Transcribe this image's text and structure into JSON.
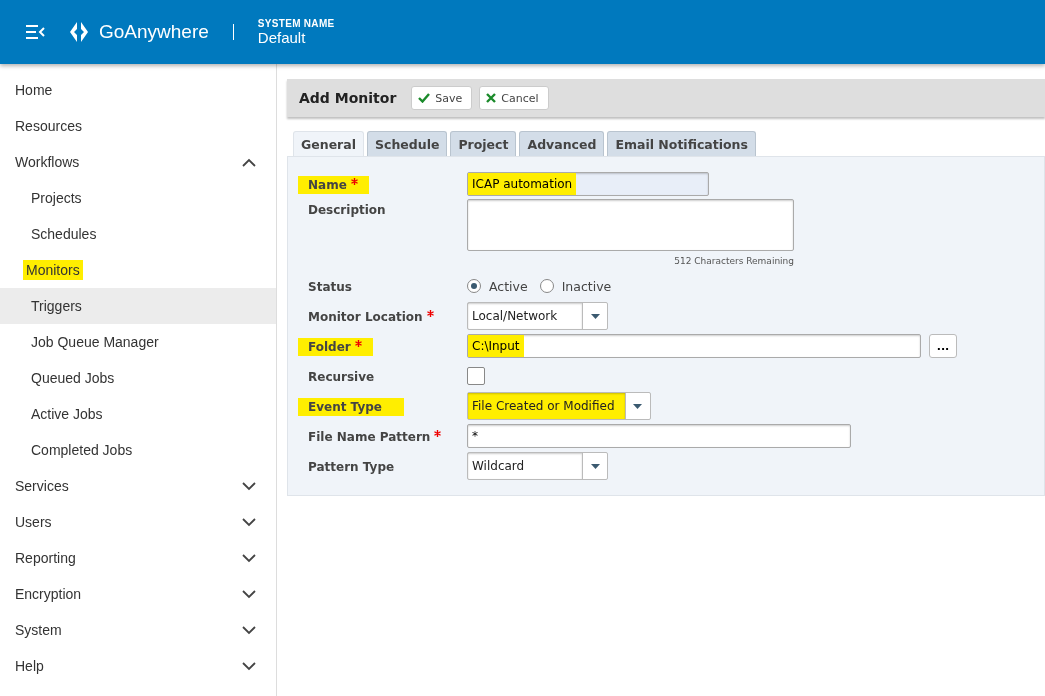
{
  "header": {
    "app_name": "GoAnywhere",
    "system_label": "SYSTEM NAME",
    "system_name": "Default"
  },
  "sidebar": {
    "items": [
      {
        "label": "Home",
        "highlighted": false
      },
      {
        "label": "Resources",
        "highlighted": false
      },
      {
        "label": "Workflows",
        "highlighted": false,
        "expanded": true,
        "children": [
          {
            "label": "Projects",
            "highlighted": false,
            "hovered": false
          },
          {
            "label": "Schedules",
            "highlighted": false,
            "hovered": false
          },
          {
            "label": "Monitors",
            "highlighted": true,
            "hovered": false
          },
          {
            "label": "Triggers",
            "highlighted": false,
            "hovered": true
          },
          {
            "label": "Job Queue Manager",
            "highlighted": false,
            "hovered": false
          },
          {
            "label": "Queued Jobs",
            "highlighted": false,
            "hovered": false
          },
          {
            "label": "Active Jobs",
            "highlighted": false,
            "hovered": false
          },
          {
            "label": "Completed Jobs",
            "highlighted": false,
            "hovered": false
          }
        ]
      },
      {
        "label": "Services",
        "highlighted": false,
        "expanded": false
      },
      {
        "label": "Users",
        "highlighted": false,
        "expanded": false
      },
      {
        "label": "Reporting",
        "highlighted": false,
        "expanded": false
      },
      {
        "label": "Encryption",
        "highlighted": false,
        "expanded": false
      },
      {
        "label": "System",
        "highlighted": false,
        "expanded": false
      },
      {
        "label": "Help",
        "highlighted": false,
        "expanded": false
      }
    ]
  },
  "form": {
    "title": "Add Monitor",
    "buttons": [
      {
        "kind": "save",
        "label": "Save"
      },
      {
        "kind": "cancel",
        "label": "Cancel"
      }
    ],
    "tabs": [
      {
        "label": "General",
        "selected": true
      },
      {
        "label": "Schedule",
        "selected": false
      },
      {
        "label": "Project",
        "selected": false
      },
      {
        "label": "Advanced",
        "selected": false
      },
      {
        "label": "Email Notifications",
        "selected": false
      }
    ],
    "fields": [
      {
        "kind": "text",
        "label": "Name",
        "required": true,
        "highlighted": true,
        "value": "ICAP automation",
        "value_highlighted": true
      },
      {
        "kind": "textarea",
        "label": "Description",
        "required": false,
        "highlighted": false,
        "hint": "512 Characters Remaining"
      },
      {
        "kind": "radio",
        "label": "Status",
        "required": false,
        "highlighted": false,
        "options": [
          {
            "label": "Active",
            "selected": true
          },
          {
            "label": "Inactive",
            "selected": false
          }
        ]
      },
      {
        "kind": "select",
        "label": "Monitor Location",
        "required": true,
        "highlighted": false,
        "value": "Local/Network",
        "value_highlighted": false
      },
      {
        "kind": "folder",
        "label": "Folder",
        "required": true,
        "highlighted": true,
        "value": "C:\\Input",
        "value_highlighted": true,
        "browse": "..."
      },
      {
        "kind": "checkbox",
        "label": "Recursive",
        "required": false,
        "highlighted": false,
        "checked": false
      },
      {
        "kind": "select",
        "label": "Event Type",
        "required": false,
        "highlighted": true,
        "value": "File Created or Modified",
        "value_highlighted": true
      },
      {
        "kind": "text",
        "label": "File Name Pattern",
        "required": true,
        "highlighted": false,
        "value": "*",
        "value_highlighted": false
      },
      {
        "kind": "select",
        "label": "Pattern Type",
        "required": false,
        "highlighted": false,
        "value": "Wildcard",
        "value_highlighted": false
      }
    ]
  }
}
